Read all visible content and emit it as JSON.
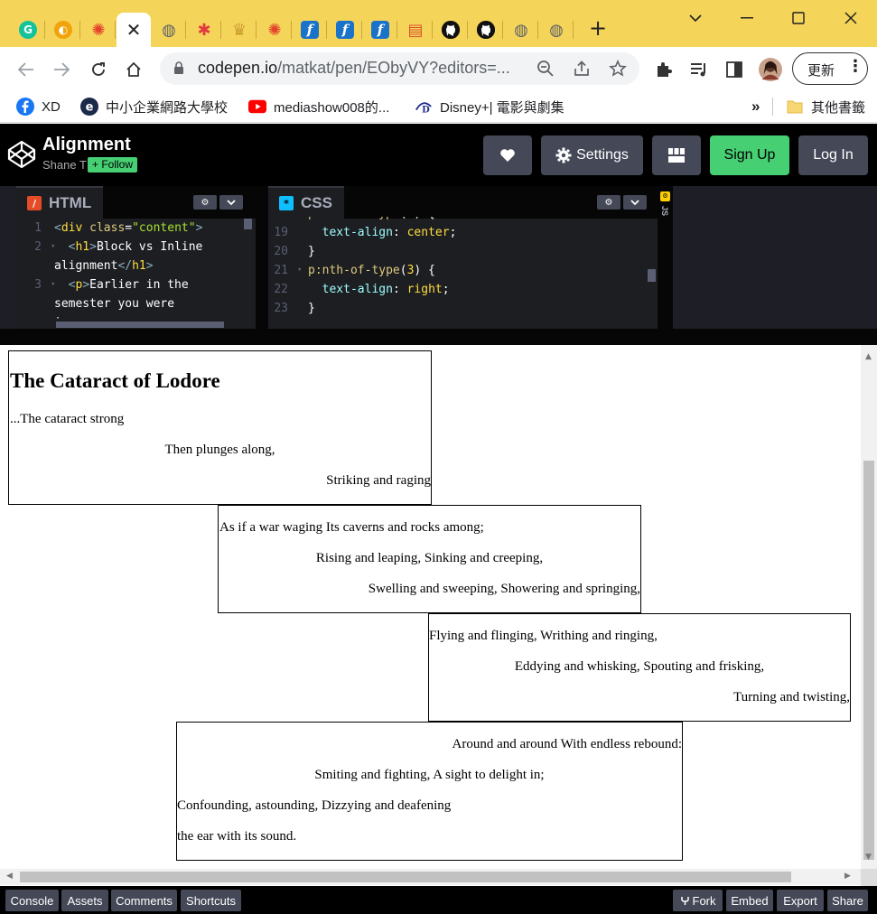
{
  "browser": {
    "tabs": [
      {
        "icon": "grammarly-icon",
        "color": "#15c39a",
        "glyph": "G"
      },
      {
        "icon": "circle-logo-icon",
        "color": "#f0a30a",
        "glyph": "◐"
      },
      {
        "icon": "wheel-icon",
        "color": "#e2432a",
        "glyph": "✺"
      },
      {
        "icon": "close-tab-icon",
        "active": true,
        "glyph": "✕"
      },
      {
        "icon": "globe-icon",
        "color": "#5f6368",
        "glyph": "◍"
      },
      {
        "icon": "asterisk-icon",
        "color": "#e03a3e",
        "glyph": "✱"
      },
      {
        "icon": "trophy-icon",
        "color": "#c99a2e",
        "glyph": "♛"
      },
      {
        "icon": "wheel-icon",
        "color": "#e2432a",
        "glyph": "✺"
      },
      {
        "icon": "f-icon",
        "color": "#1a73c9",
        "glyph": "f"
      },
      {
        "icon": "f-icon",
        "color": "#1a73c9",
        "glyph": "f"
      },
      {
        "icon": "f-icon",
        "color": "#1a73c9",
        "glyph": "f"
      },
      {
        "icon": "calendar-icon",
        "color": "#d8532a",
        "glyph": "▤"
      },
      {
        "icon": "github-icon",
        "color": "#111",
        "glyph": "●"
      },
      {
        "icon": "github-icon",
        "color": "#111",
        "glyph": "●"
      },
      {
        "icon": "globe-icon",
        "color": "#5f6368",
        "glyph": "◍"
      },
      {
        "icon": "globe-icon",
        "color": "#5f6368",
        "glyph": "◍"
      }
    ],
    "url_main": "codepen.io",
    "url_rest": "/matkat/pen/EObyVY?editors=...",
    "update_label": "更新"
  },
  "bookmarks": [
    {
      "label": "XD",
      "icon": "facebook-icon",
      "color": "#1877f2"
    },
    {
      "label": "中小企業網路大學校",
      "icon": "e-logo-icon",
      "color": "#1b2a4a"
    },
    {
      "label": "mediashow008的...",
      "icon": "youtube-icon",
      "color": "#ff0000"
    },
    {
      "label": "Disney+| 電影與劇集",
      "icon": "disney-icon",
      "color": "#1f2b8c"
    }
  ],
  "bookmarks_more": "»",
  "bookmarks_folder": "其他書籤",
  "codepen": {
    "title": "Alignment",
    "author": "Shane T",
    "follow": "+ Follow",
    "settings": "Settings",
    "signup": "Sign Up",
    "login": "Log In"
  },
  "editors": {
    "html_label": "HTML",
    "css_label": "CSS",
    "js_label": "JS"
  },
  "preview": {
    "title": "The Cataract of Lodore",
    "box1": [
      "...The cataract strong",
      "Then plunges along,",
      "Striking and raging"
    ],
    "box2": [
      "As if a war waging Its caverns and rocks among;",
      "Rising and leaping, Sinking and creeping,",
      "Swelling and sweeping, Showering and springing,"
    ],
    "box3": [
      "Flying and flinging, Writhing and ringing,",
      "Eddying and whisking, Spouting and frisking,",
      "Turning and twisting,"
    ],
    "box4": [
      "Around and around With endless rebound:",
      "Smiting and fighting, A sight to delight in;",
      "Confounding, astounding, Dizzying and deafening",
      "the ear with its sound."
    ]
  },
  "bottom": {
    "console": "Console",
    "assets": "Assets",
    "comments": "Comments",
    "shortcuts": "Shortcuts",
    "fork": "Fork",
    "embed": "Embed",
    "export": "Export",
    "share": "Share"
  }
}
